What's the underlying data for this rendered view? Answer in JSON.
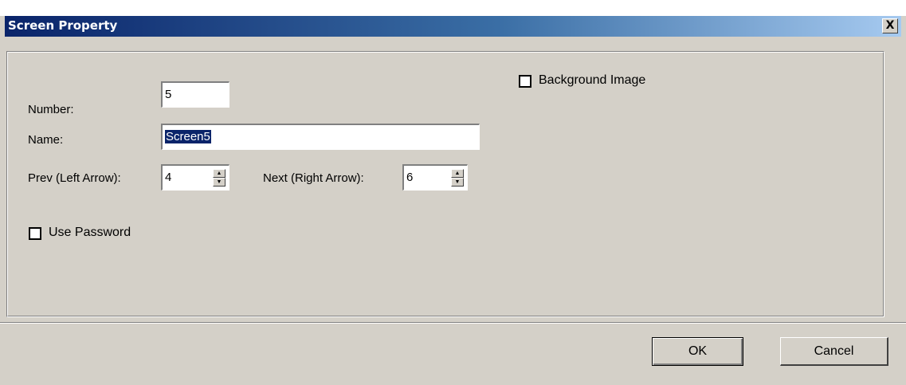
{
  "window": {
    "title": "Screen Property",
    "close_glyph": "X"
  },
  "form": {
    "number_label": "Number:",
    "number_value": "5",
    "name_label": "Name:",
    "name_value": "Screen5",
    "prev_label": "Prev (Left Arrow):",
    "prev_value": "4",
    "next_label": "Next (Right Arrow):",
    "next_value": "6",
    "use_password_label": "Use Password",
    "use_password_checked": false,
    "background_image_label": "Background Image",
    "background_image_checked": false
  },
  "buttons": {
    "ok_label": "OK",
    "cancel_label": "Cancel"
  },
  "icons": {
    "close": "close-icon",
    "spin_up": "up-arrow-icon",
    "spin_down": "down-arrow-icon"
  }
}
